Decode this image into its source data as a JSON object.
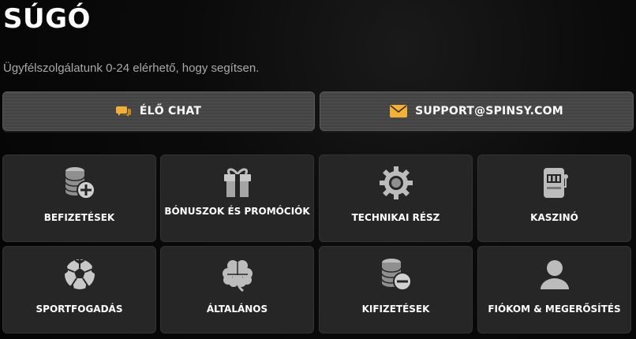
{
  "page": {
    "title": "SÚGÓ",
    "subtitle": "Ügyfélszolgálatunk 0-24 elérhető, hogy segítsen."
  },
  "contact": {
    "chat_label": "ÉLŐ CHAT",
    "chat_icon": "chat-bubble-icon",
    "email_label": "SUPPORT@SPINSY.COM",
    "email_icon": "envelope-icon",
    "accent_color": "#f2b134"
  },
  "categories": [
    {
      "label": "BEFIZETÉSEK",
      "icon": "coins-plus-icon"
    },
    {
      "label": "BÓNUSZOK ÉS PROMÓCIÓK",
      "icon": "gift-icon"
    },
    {
      "label": "TECHNIKAI RÉSZ",
      "icon": "gear-icon"
    },
    {
      "label": "KASZINÓ",
      "icon": "slot-machine-icon"
    },
    {
      "label": "SPORTFOGADÁS",
      "icon": "soccer-ball-icon"
    },
    {
      "label": "ÁLTALÁNOS",
      "icon": "clover-icon"
    },
    {
      "label": "KIFIZETÉSEK",
      "icon": "coins-minus-icon"
    },
    {
      "label": "FIÓKOM & MEGERŐSÍTÉS",
      "icon": "user-icon"
    }
  ],
  "colors": {
    "background": "#080808",
    "card": "#262626",
    "icon": "#bcbcbc"
  }
}
